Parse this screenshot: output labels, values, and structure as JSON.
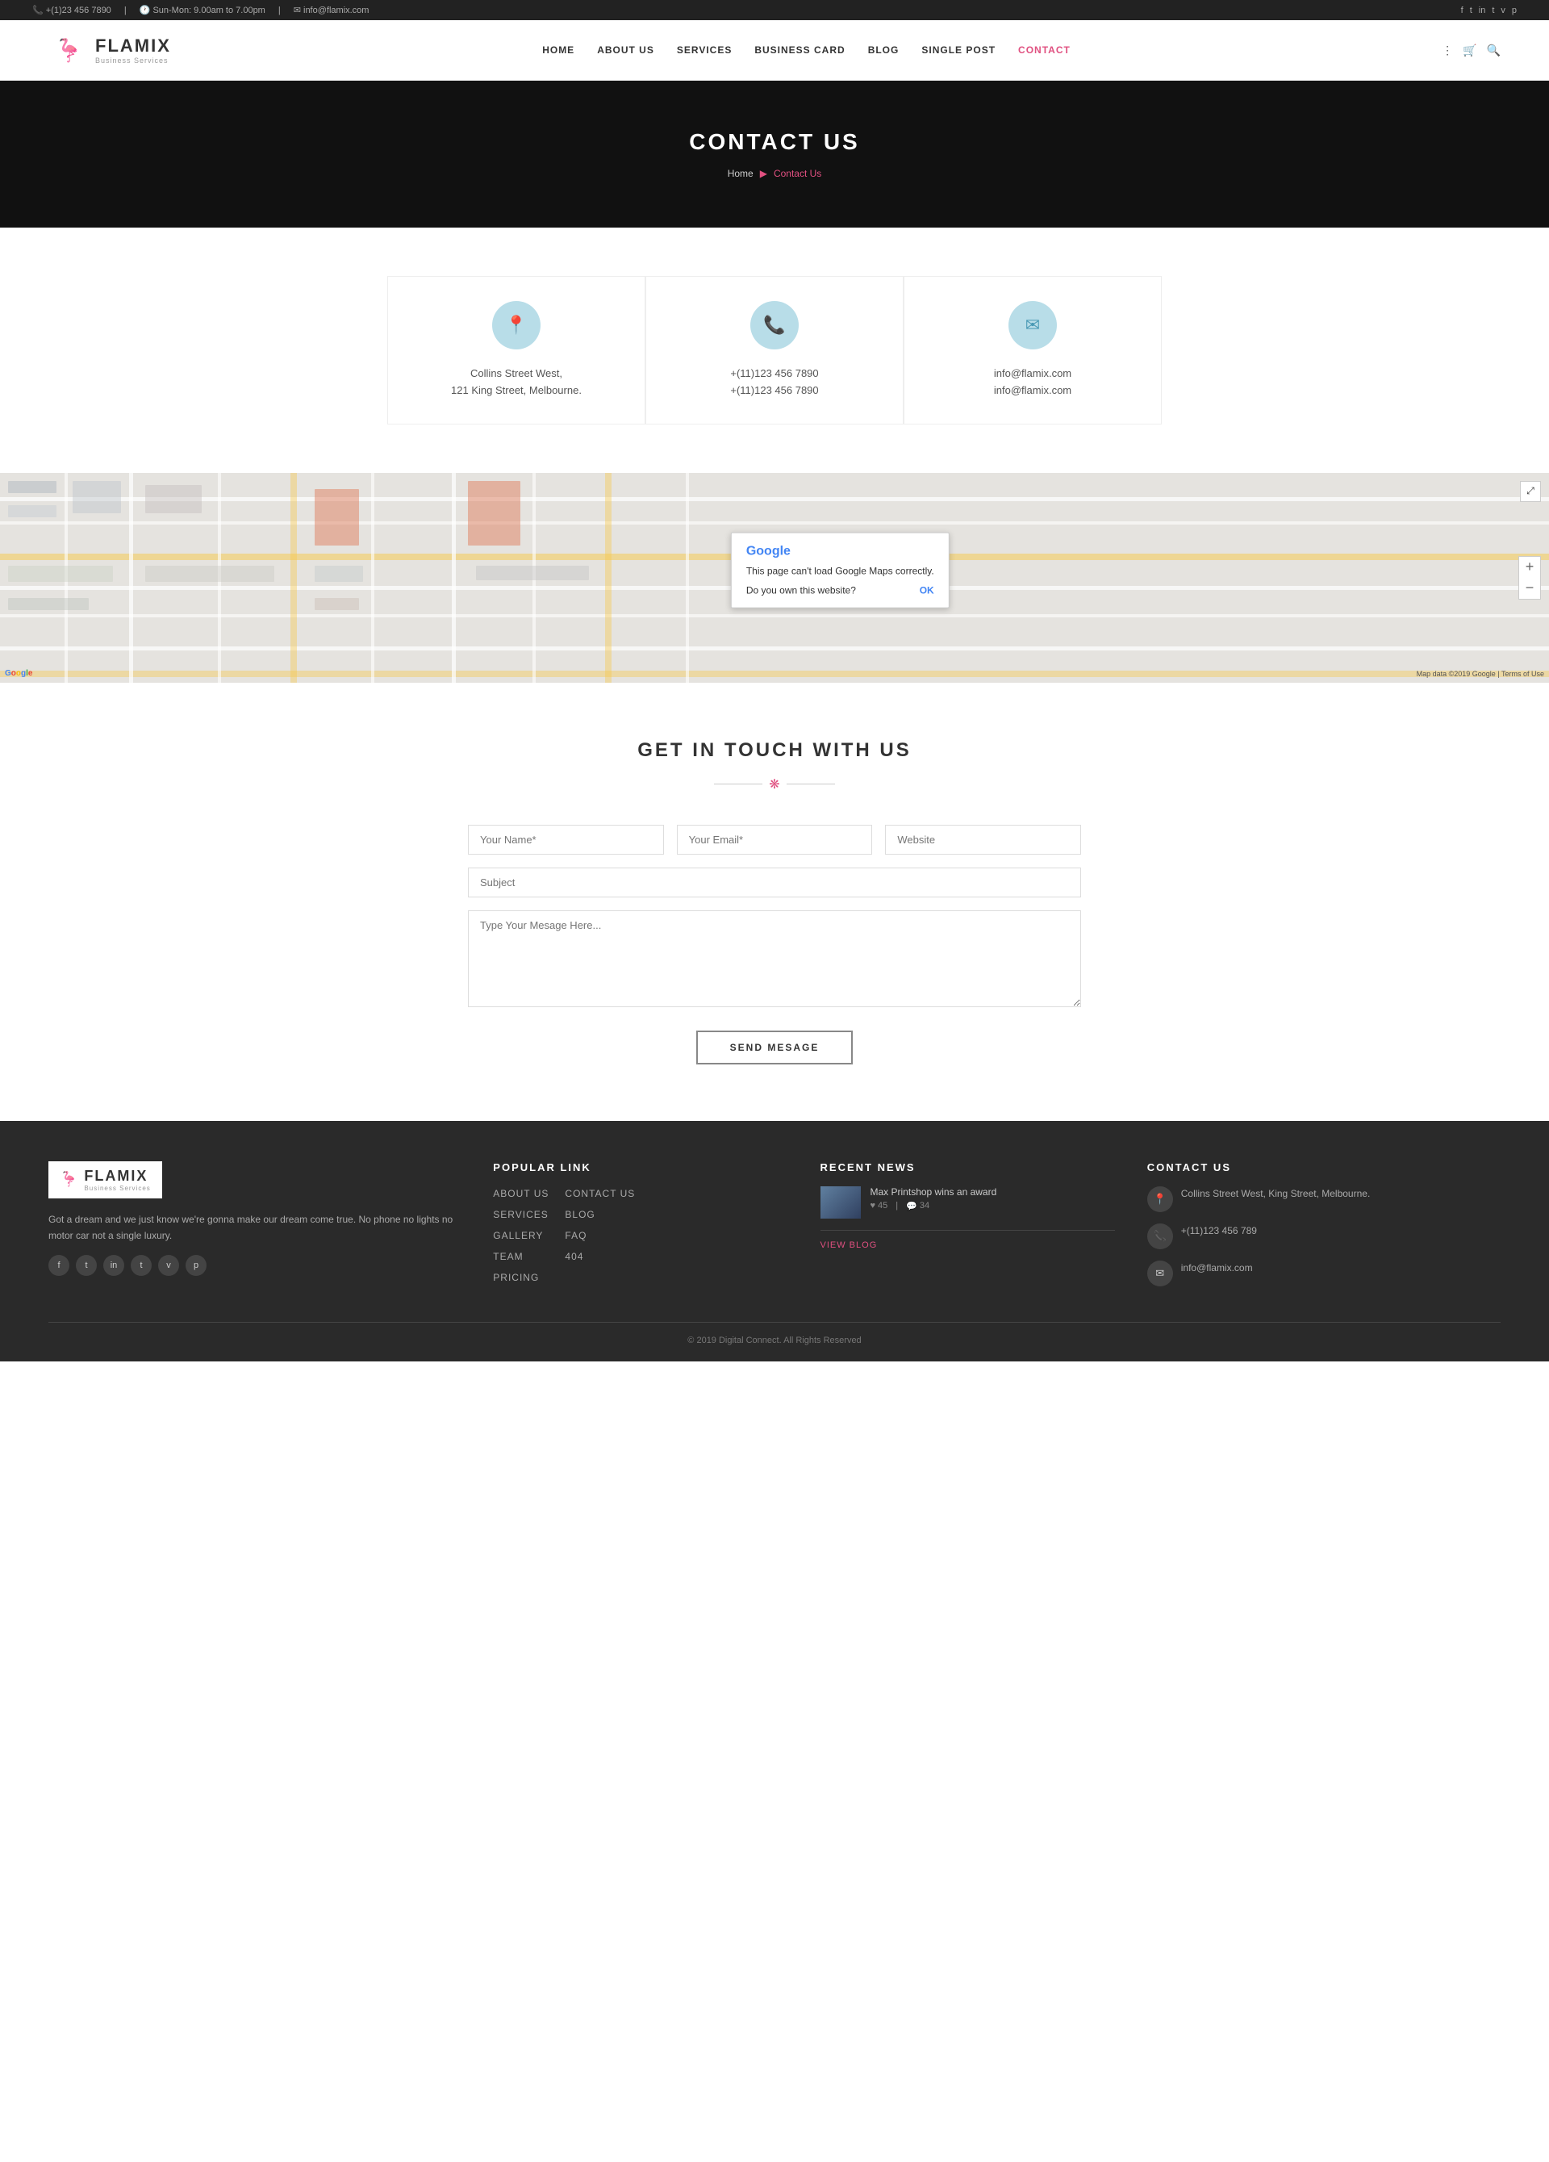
{
  "topbar": {
    "phone": "+(1)23 456 7890",
    "hours": "Sun-Mon: 9.00am to 7.00pm",
    "email": "info@flamix.com",
    "social_icons": [
      "f",
      "t",
      "in",
      "t",
      "v",
      "p"
    ]
  },
  "header": {
    "logo_name": "FLAMIX",
    "logo_sub": "Business Services",
    "nav": [
      {
        "label": "HOME",
        "href": "#",
        "active": false
      },
      {
        "label": "ABOUT US",
        "href": "#",
        "active": false
      },
      {
        "label": "SERVICES",
        "href": "#",
        "active": false
      },
      {
        "label": "BUSINESS CARD",
        "href": "#",
        "active": false
      },
      {
        "label": "BLOG",
        "href": "#",
        "active": false
      },
      {
        "label": "SINGLE POST",
        "href": "#",
        "active": false
      },
      {
        "label": "CONTACT",
        "href": "#",
        "active": true
      }
    ]
  },
  "hero": {
    "title": "CONTACT US",
    "breadcrumb_home": "Home",
    "breadcrumb_current": "Contact Us"
  },
  "contact_cards": [
    {
      "icon": "📍",
      "line1": "Collins Street West,",
      "line2": "121 King Street, Melbourne."
    },
    {
      "icon": "📞",
      "line1": "+(11)123 456 7890",
      "line2": "+(11)123 456 7890"
    },
    {
      "icon": "✉",
      "line1": "info@flamix.com",
      "line2": "info@flamix.com"
    }
  ],
  "map": {
    "dialog_brand": "Google",
    "dialog_message": "This page can't load Google Maps correctly.",
    "dialog_question": "Do you own this website?",
    "dialog_ok": "OK",
    "zoom_in": "+",
    "zoom_out": "−",
    "map_data_text": "Map data ©2019 Google | Terms of Use"
  },
  "get_in_touch": {
    "title": "GET IN TOUCH WITH US",
    "name_placeholder": "Your Name*",
    "email_placeholder": "Your Email*",
    "website_placeholder": "Website",
    "subject_placeholder": "Subject",
    "message_placeholder": "Type Your Mesage Here...",
    "send_button": "SEND MESAGE"
  },
  "footer": {
    "logo_name": "FLAMIX",
    "logo_sub": "Business Services",
    "about_text": "Got a dream and we just know we're gonna make our dream come true. No phone no lights no motor car not a single luxury.",
    "social_icons": [
      "f",
      "t",
      "in",
      "t",
      "v",
      "p"
    ],
    "popular_links_title": "POPULAR LINK",
    "popular_links": [
      {
        "label": "ABOUT US",
        "href": "#"
      },
      {
        "label": "SERVICES",
        "href": "#"
      },
      {
        "label": "GALLERY",
        "href": "#"
      },
      {
        "label": "TEAM",
        "href": "#"
      },
      {
        "label": "PRICING",
        "href": "#"
      }
    ],
    "popular_links_col2": [
      {
        "label": "CONTACT US",
        "href": "#"
      },
      {
        "label": "BLOG",
        "href": "#"
      },
      {
        "label": "FAQ",
        "href": "#"
      },
      {
        "label": "404",
        "href": "#"
      }
    ],
    "recent_news_title": "RECENT NEWS",
    "news_item": {
      "title": "Max Printshop wins an award",
      "likes": "45",
      "comments": "34",
      "view_blog": "VIEW BLOG"
    },
    "contact_title": "CONTACT US",
    "contact_address": "Collins Street West, King Street, Melbourne.",
    "contact_phone": "+(11)123 456 789",
    "contact_email": "info@flamix.com",
    "copyright": "© 2019 Digital Connect. All Rights Reserved"
  }
}
